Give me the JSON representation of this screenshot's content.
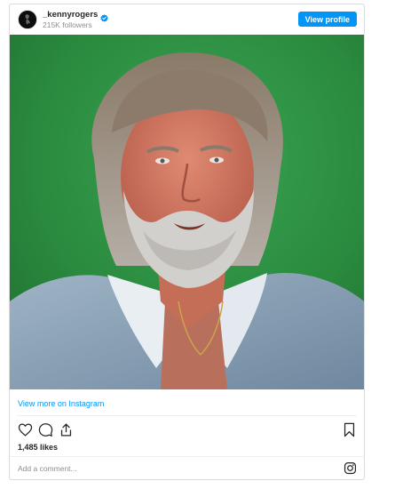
{
  "header": {
    "username": "_kennyrogers",
    "followers": "215K followers",
    "view_profile_label": "View profile",
    "verified_color": "#0095f6"
  },
  "post": {
    "image_icon": "portrait-photo",
    "background_color": "#2a8a3e"
  },
  "footer": {
    "view_more_label": "View more on Instagram",
    "likes": "1,485 likes",
    "comment_placeholder": "Add a comment...",
    "icons": [
      "heart-icon",
      "comment-icon",
      "share-icon",
      "bookmark-icon",
      "instagram-icon"
    ]
  },
  "colors": {
    "accent": "#0095f6",
    "text": "#262626",
    "muted": "#8e8e8e"
  }
}
